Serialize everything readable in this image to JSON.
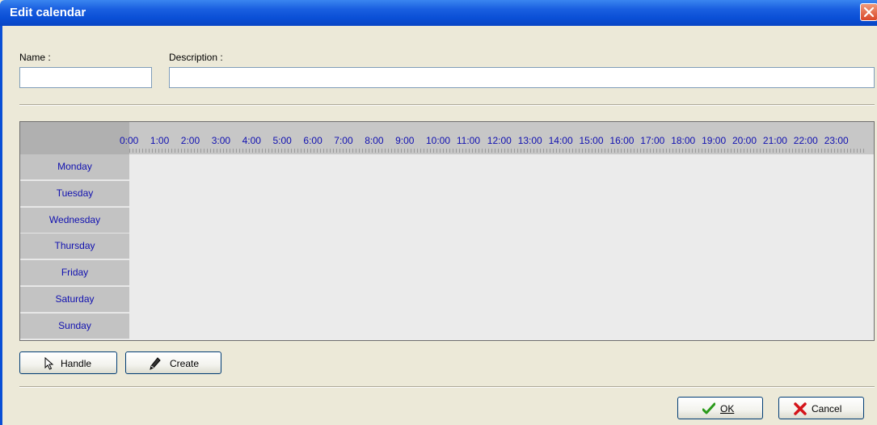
{
  "window": {
    "title": "Edit calendar"
  },
  "form": {
    "name_label": "Name :",
    "name_value": "",
    "description_label": "Description :",
    "description_value": ""
  },
  "schedule": {
    "hours": [
      "0:00",
      "1:00",
      "2:00",
      "3:00",
      "4:00",
      "5:00",
      "6:00",
      "7:00",
      "8:00",
      "9:00",
      "10:00",
      "11:00",
      "12:00",
      "13:00",
      "14:00",
      "15:00",
      "16:00",
      "17:00",
      "18:00",
      "19:00",
      "20:00",
      "21:00",
      "22:00",
      "23:00"
    ],
    "days": [
      "Monday",
      "Tuesday",
      "Wednesday",
      "Thursday",
      "Friday",
      "Saturday",
      "Sunday"
    ]
  },
  "tools": {
    "handle_label": "Handle",
    "create_label": "Create"
  },
  "footer": {
    "ok_label": "OK",
    "cancel_label": "Cancel"
  },
  "colors": {
    "title_bar": "#0a4fd6",
    "grid_text": "#1010b0",
    "background": "#ece9d8"
  },
  "icons": {
    "handle": "cursor-arrow-icon",
    "create": "pencil-icon",
    "ok": "checkmark-icon",
    "cancel": "x-icon",
    "close": "close-icon"
  }
}
